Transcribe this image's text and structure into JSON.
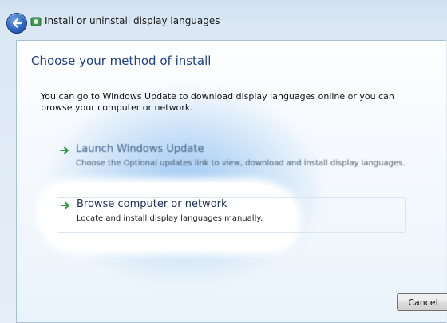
{
  "window": {
    "title": "Install or uninstall display languages"
  },
  "page": {
    "heading": "Choose your method of install",
    "description": "You can go to Windows Update to download display languages online or you can browse your computer or network."
  },
  "options": [
    {
      "title": "Launch Windows Update",
      "subtitle": "Choose the Optional updates link to view, download and install display languages."
    },
    {
      "title": "Browse computer or network",
      "subtitle": "Locate and install display languages manually."
    }
  ],
  "footer": {
    "cancel_label": "Cancel"
  },
  "icons": {
    "back": "back-arrow-icon",
    "option_arrow": "green-arrow-icon",
    "title_icon": "languages-icon"
  },
  "colors": {
    "heading": "#1e3f8a",
    "arrow": "#2e9e3a"
  }
}
